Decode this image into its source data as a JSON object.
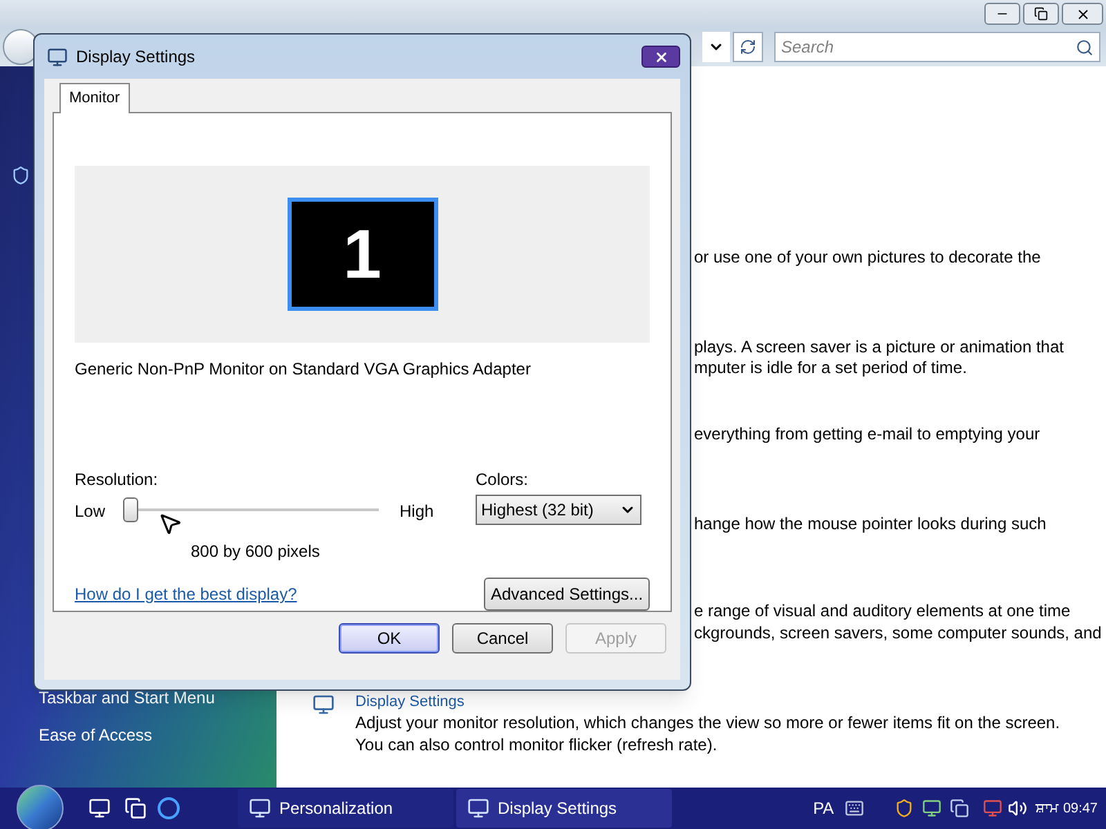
{
  "explorer": {
    "search": {
      "placeholder": "Search"
    },
    "sidebar": {
      "items": [
        "Taskbar and Start Menu",
        "Ease of Access"
      ]
    },
    "content_lines": [
      "or use one of your own pictures to decorate the",
      "plays. A screen saver is a picture or animation that",
      "mputer is idle for a set period of time.",
      "everything from getting e-mail to emptying your",
      "hange how the mouse pointer looks during such",
      "e range of visual and auditory elements at one time",
      "ckgrounds, screen savers, some computer sounds, and"
    ],
    "section": {
      "title": "Display Settings",
      "description": [
        "Adjust your monitor resolution, which changes the view so more or fewer items fit on the screen.",
        "You can also control monitor flicker (refresh rate)."
      ]
    }
  },
  "dialog": {
    "title": "Display Settings",
    "tabs": [
      {
        "label": "Monitor",
        "selected": true
      }
    ],
    "monitor": {
      "number": "1",
      "selected": true
    },
    "adapter": "Generic Non-PnP Monitor on Standard VGA Graphics Adapter",
    "resolution": {
      "label": "Resolution:",
      "low": "Low",
      "high": "High",
      "level": 0,
      "reading": "800 by 600 pixels"
    },
    "colors": {
      "label": "Colors:",
      "value": "Highest (32 bit)"
    },
    "help_link": "How do I get the best display?",
    "advanced_button": "Advanced Settings...",
    "buttons": [
      {
        "label": "OK",
        "kind": "default",
        "disabled": false
      },
      {
        "label": "Cancel",
        "kind": "normal",
        "disabled": false
      },
      {
        "label": "Apply",
        "kind": "normal",
        "disabled": true
      }
    ]
  },
  "taskbar": {
    "tasks": [
      {
        "label": "Personalization",
        "selected": false
      },
      {
        "label": "Display Settings",
        "selected": true
      }
    ],
    "language": "PA",
    "clock": "ਸ਼ਾਮ 09:47"
  }
}
